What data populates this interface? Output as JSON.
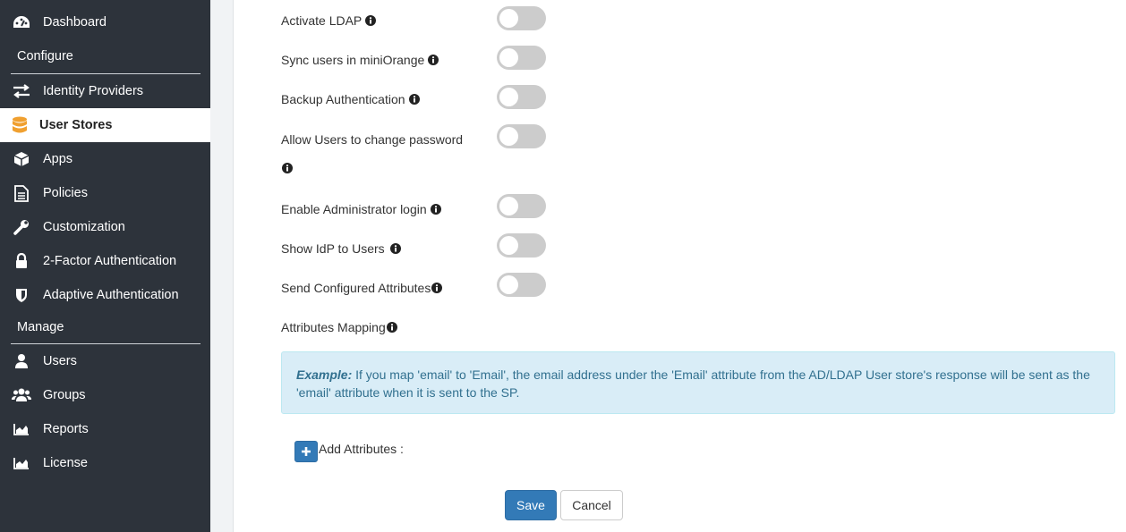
{
  "sidebar": {
    "items": [
      {
        "label": "Dashboard",
        "icon": "dashboard-icon"
      },
      {
        "label": "Identity Providers",
        "icon": "exchange-icon"
      },
      {
        "label": "User Stores",
        "icon": "database-icon"
      },
      {
        "label": "Apps",
        "icon": "cube-icon"
      },
      {
        "label": "Policies",
        "icon": "document-icon"
      },
      {
        "label": "Customization",
        "icon": "wrench-icon"
      },
      {
        "label": "2-Factor Authentication",
        "icon": "lock-icon"
      },
      {
        "label": "Adaptive Authentication",
        "icon": "shield-icon"
      },
      {
        "label": "Users",
        "icon": "user-icon"
      },
      {
        "label": "Groups",
        "icon": "users-icon"
      },
      {
        "label": "Reports",
        "icon": "area-chart-icon"
      },
      {
        "label": "License",
        "icon": "area-chart-icon"
      }
    ],
    "sections": {
      "configure": "Configure",
      "manage": "Manage"
    },
    "active_item": "User Stores"
  },
  "settings": {
    "rows": [
      {
        "label": "Activate LDAP",
        "enabled": false
      },
      {
        "label": "Sync users in miniOrange",
        "enabled": false
      },
      {
        "label": "Backup Authentication",
        "enabled": false
      },
      {
        "label": "Allow Users to change password",
        "enabled": false
      },
      {
        "label": "Enable Administrator login",
        "enabled": false
      },
      {
        "label": "Show IdP to Users",
        "enabled": false
      },
      {
        "label": "Send Configured Attributes",
        "enabled": false
      }
    ],
    "attributes_mapping_label": "Attributes Mapping"
  },
  "example": {
    "title": "Example:",
    "text": "If you map 'email' to 'Email', the email address under the 'Email' attribute from the AD/LDAP User store's response will be sent as the 'email' attribute when it is sent to the SP."
  },
  "add_attributes_label": "Add Attributes :",
  "buttons": {
    "save": "Save",
    "cancel": "Cancel"
  },
  "colors": {
    "sidebar_bg": "#2d333b",
    "accent": "#337ab7",
    "active_icon": "#f0a030",
    "info_bg": "#d9edf7"
  }
}
